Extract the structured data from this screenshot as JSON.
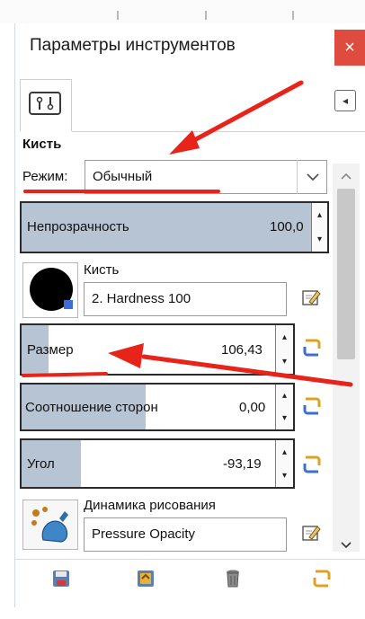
{
  "panel": {
    "title": "Параметры инструментов",
    "close_symbol": "×",
    "menu_symbol": "◂"
  },
  "section": {
    "title": "Кисть"
  },
  "mode": {
    "label": "Режим:",
    "value": "Обычный"
  },
  "opacity": {
    "label": "Непрозрачность",
    "value": "100,0",
    "fraction": 1.0
  },
  "brush": {
    "label": "Кисть",
    "name": "2. Hardness 100"
  },
  "size": {
    "label": "Размер",
    "value": "106,43"
  },
  "aspect": {
    "label": "Соотношение сторон",
    "value": "0,00"
  },
  "angle": {
    "label": "Угол",
    "value": "-93,19"
  },
  "dynamics": {
    "label": "Динамика рисования",
    "name": "Pressure Opacity"
  },
  "icons": {
    "tab": "tool-options-icon",
    "edit": "edit-icon",
    "link": "link-icon",
    "save": "save-preset-icon",
    "restore": "restore-preset-icon",
    "delete": "delete-preset-icon",
    "reset": "reset-icon"
  },
  "colors": {
    "close": "#e04b3f",
    "slider_fill": "#b6c4d3",
    "annotation": "#e8231a",
    "link_icon": "#e0a020"
  }
}
